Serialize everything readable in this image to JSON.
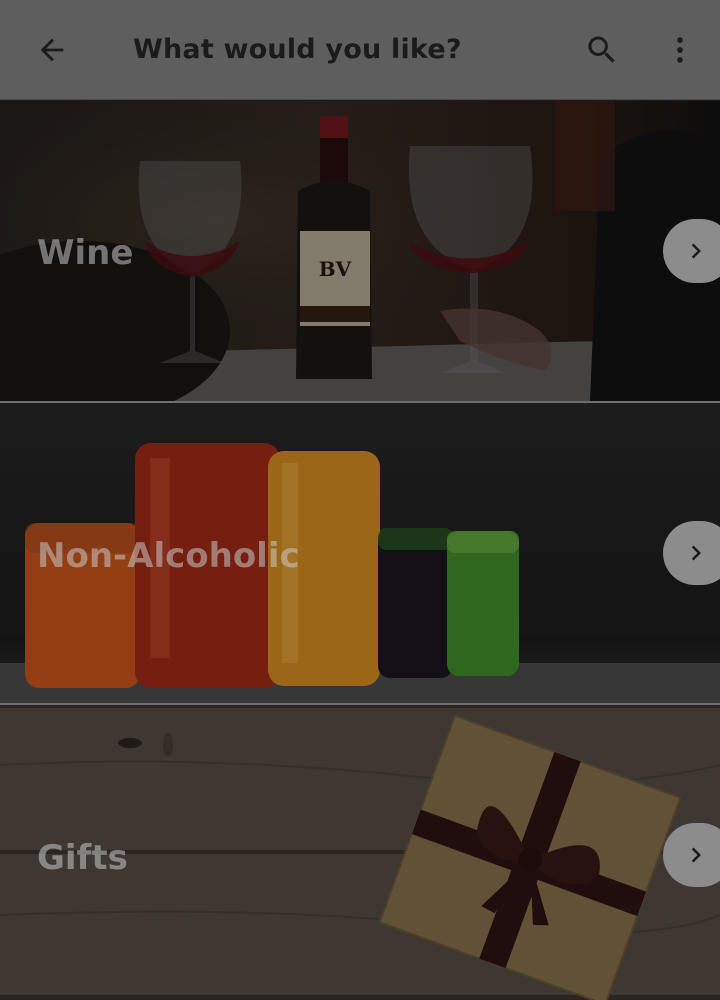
{
  "header": {
    "title": "What would you like?",
    "back_icon": "arrow-left-icon",
    "search_icon": "search-icon",
    "more_icon": "more-vert-icon"
  },
  "categories": [
    {
      "label": "Wine",
      "icon": "chevron-right-icon"
    },
    {
      "label": "Non-Alcoholic",
      "icon": "chevron-right-icon"
    },
    {
      "label": "Gifts",
      "icon": "chevron-right-icon"
    }
  ],
  "colors": {
    "app_bar": "#5e5e5e",
    "overlay": "#000000",
    "arrow_button": "#8c8c8c"
  }
}
